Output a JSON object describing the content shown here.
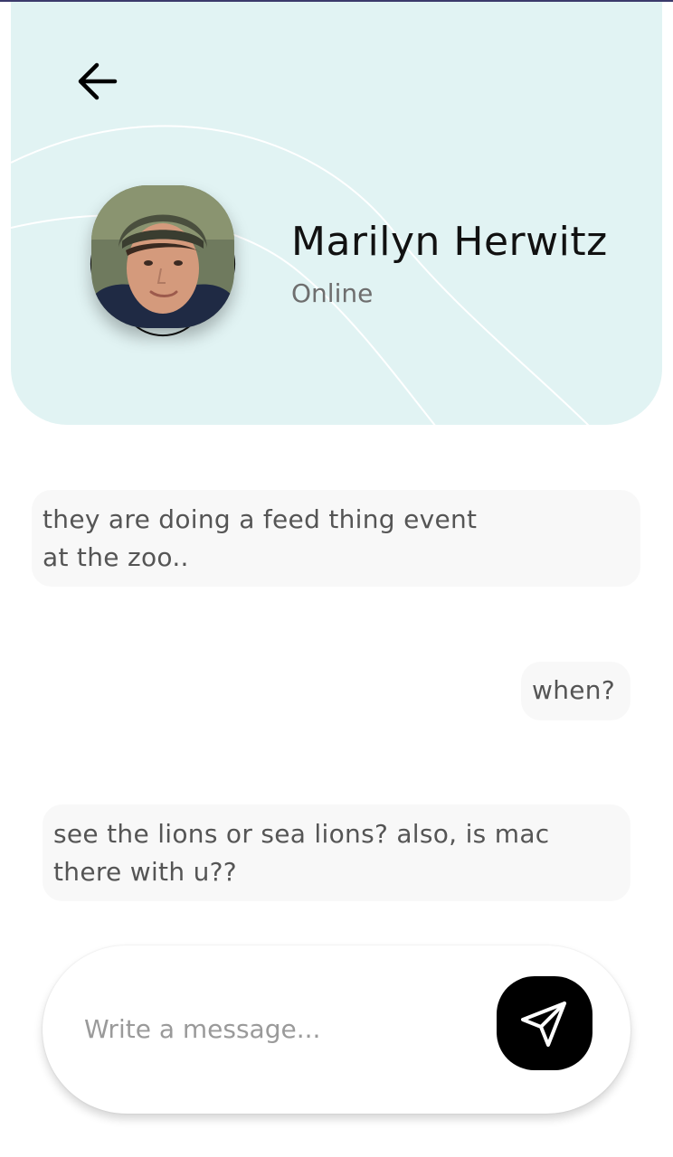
{
  "contact": {
    "name": "Marilyn Herwitz",
    "status": "Online"
  },
  "icons": {
    "back": "arrow-left-icon",
    "send": "paper-plane-icon"
  },
  "messages": [
    {
      "direction": "incoming",
      "lines": [
        "they are doing a feed thing event",
        "at the zoo.."
      ]
    },
    {
      "direction": "outgoing",
      "lines": [
        "when?"
      ]
    },
    {
      "direction": "incoming",
      "lines": [
        "see the lions or sea lions? also, is mac",
        "there with u??"
      ]
    }
  ],
  "composer": {
    "placeholder": "Write a message..."
  },
  "colors": {
    "header_bg": "#e1f3f3",
    "bubble_bg": "#f8f8f8",
    "send_button_bg": "#000000"
  }
}
